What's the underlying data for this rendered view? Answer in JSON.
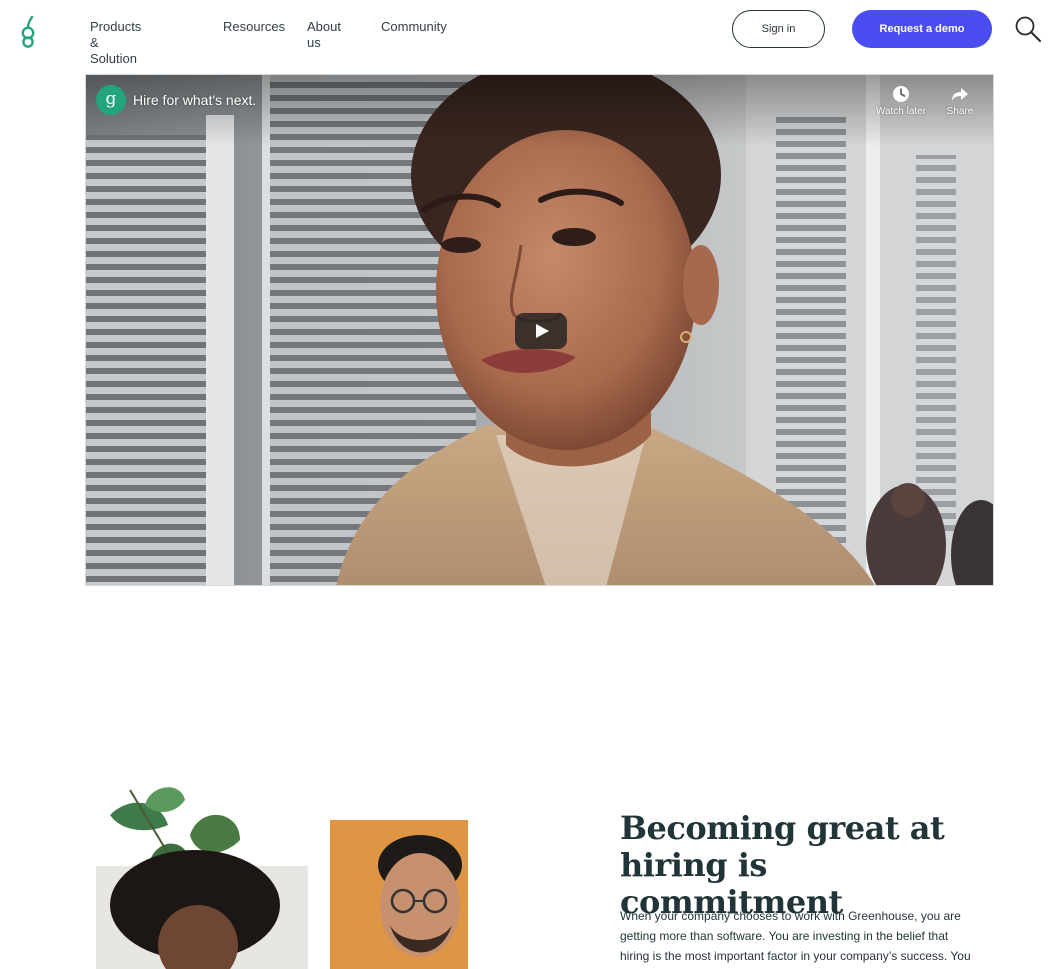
{
  "header": {
    "logo_glyph": "g",
    "nav": [
      "Products & Solution",
      "Resources",
      "About us",
      "Community"
    ],
    "signin_label": "Sign in",
    "demo_label": "Request a demo",
    "brand_color": "#23a47c",
    "accent_color": "#4a4ef0"
  },
  "video": {
    "channel_glyph": "g",
    "title": "Hire for what's next.",
    "watch_later_label": "Watch later",
    "share_label": "Share"
  },
  "section": {
    "heading_line1": "Becoming great at",
    "heading_line2": "hiring is commitment",
    "body": "When your company chooses to work with Greenhouse, you are getting more than software. You are investing in the belief that hiring is the most important factor in your company’s success. You"
  }
}
